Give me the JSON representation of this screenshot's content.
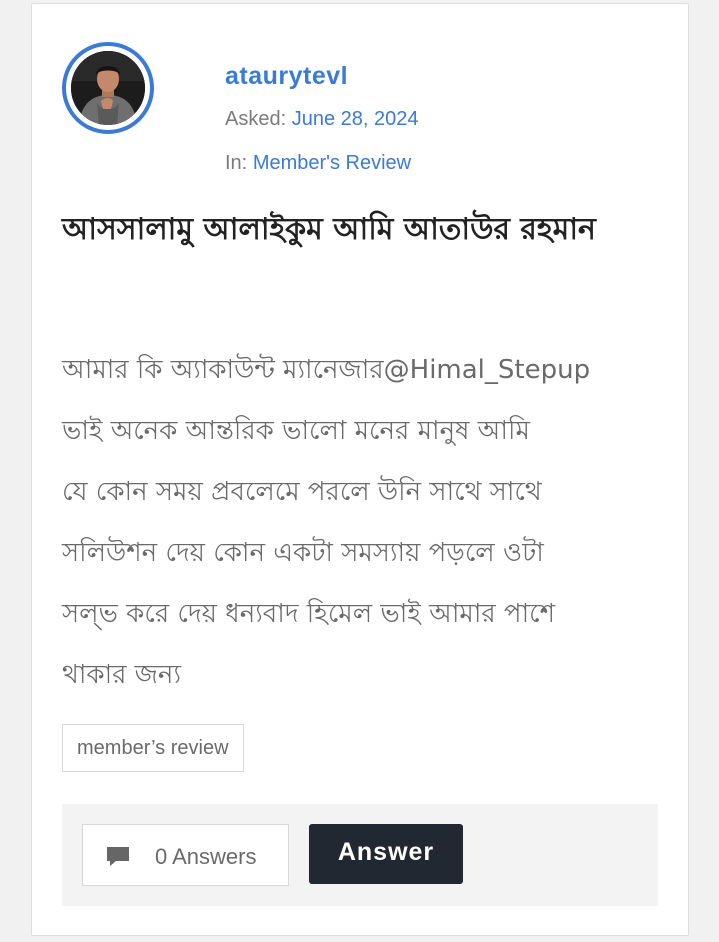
{
  "question": {
    "author": {
      "username": "ataurytevl",
      "avatar_icon": "user-avatar-photo"
    },
    "asked_label": "Asked:",
    "asked_date": "June 28, 2024",
    "category_label": "In:",
    "category": "Member's Review",
    "title": "আসসালামু আলাইকুম আমি আতাউর রহমান",
    "body": "আমার কি অ্যাকাউন্ট ম্যানেজার@Himal_Stepup\n ভাই  অনেক আন্তরিক  ভালো মনের মানুষ  আমি\nযে কোন সময় প্রবলেমে পরলে  উনি সাথে সাথে\nসলিউশন দেয় কোন একটা সমস্যায় পড়লে  ওটা\nসল্ভ করে দেয়  ধন্যবাদ হিমেল ভাই  আমার পাশে\nথাকার জন্য",
    "tags": [
      "member’s review"
    ]
  },
  "footer": {
    "answers_count_label": "0 Answers",
    "answers_icon": "comment-icon",
    "answer_button_label": "Answer"
  },
  "colors": {
    "accent": "#3a7bd5",
    "dark_button": "#222831",
    "muted_text": "#6a6a6a",
    "footer_bg": "#f3f3f3"
  }
}
